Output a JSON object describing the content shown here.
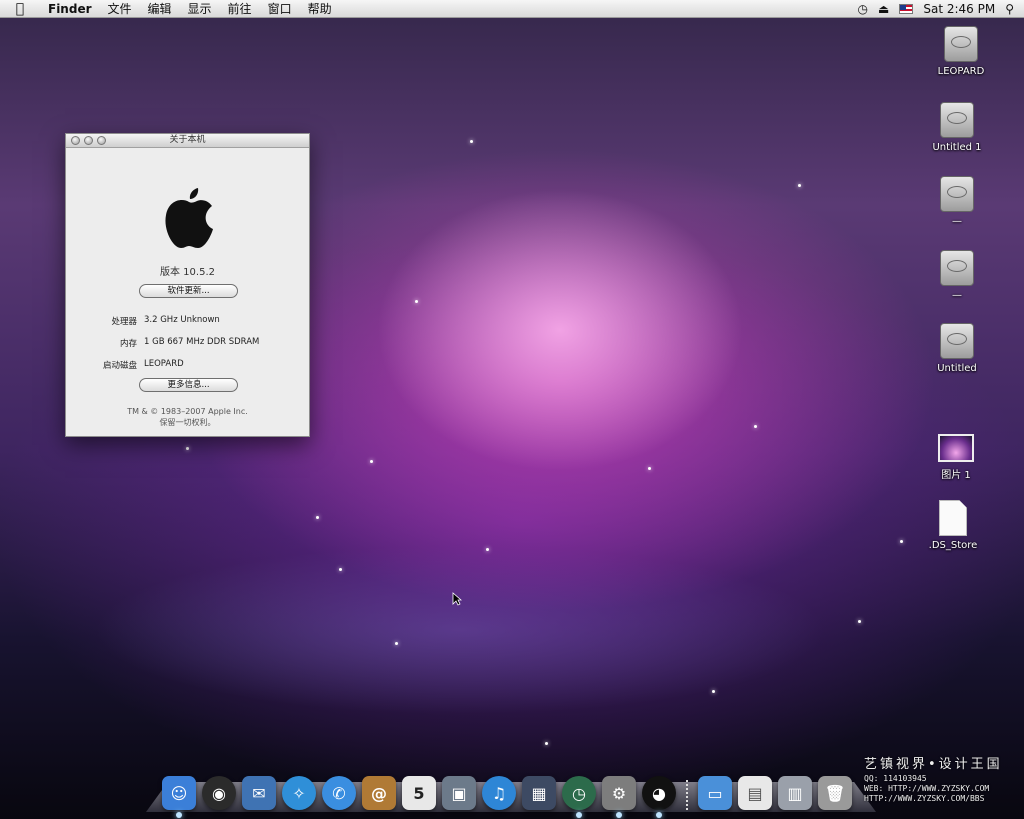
{
  "menubar": {
    "app": "Finder",
    "items": [
      "文件",
      "编辑",
      "显示",
      "前往",
      "窗口",
      "帮助"
    ],
    "clock": "Sat 2:46 PM",
    "status_icons": [
      "time-machine-icon",
      "eject-icon",
      "us-flag-icon",
      "spotlight-icon"
    ]
  },
  "about_window": {
    "title": "关于本机",
    "version": "版本 10.5.2",
    "software_update_button": "软件更新...",
    "rows": [
      {
        "key": "处理器",
        "value": "3.2 GHz Unknown"
      },
      {
        "key": "内存",
        "value": "1 GB 667 MHz DDR SDRAM"
      },
      {
        "key": "启动磁盘",
        "value": "LEOPARD"
      }
    ],
    "more_info_button": "更多信息...",
    "copyright_line1": "TM & © 1983–2007 Apple Inc.",
    "copyright_line2": "保留一切权利。"
  },
  "desktop_icons": [
    {
      "label": "LEOPARD",
      "kind": "drive"
    },
    {
      "label": "Untitled 1",
      "kind": "drive"
    },
    {
      "label": "—",
      "kind": "drive"
    },
    {
      "label": "—",
      "kind": "drive"
    },
    {
      "label": "Untitled",
      "kind": "drive"
    },
    {
      "label": "图片 1",
      "kind": "image"
    },
    {
      "label": ".DS_Store",
      "kind": "document"
    }
  ],
  "dock": {
    "apps": [
      {
        "name": "finder-icon",
        "glyph": "☺",
        "color": "#3b7fd8",
        "running": true
      },
      {
        "name": "dashboard-icon",
        "glyph": "◉",
        "color": "#2b2b2b",
        "running": false
      },
      {
        "name": "mail-icon",
        "glyph": "✉",
        "color": "#3f73b3",
        "running": false
      },
      {
        "name": "safari-icon",
        "glyph": "✧",
        "color": "#2f8fd8",
        "running": false
      },
      {
        "name": "ichat-icon",
        "glyph": "✆",
        "color": "#3a8ee0",
        "running": false
      },
      {
        "name": "address-book-icon",
        "glyph": "@",
        "color": "#b07a35",
        "running": false
      },
      {
        "name": "ical-icon",
        "glyph": "5",
        "color": "#d9d9d9",
        "running": false
      },
      {
        "name": "iphoto-icon",
        "glyph": "▣",
        "color": "#6c7a8a",
        "running": false
      },
      {
        "name": "itunes-icon",
        "glyph": "♫",
        "color": "#2e86d6",
        "running": false
      },
      {
        "name": "spaces-icon",
        "glyph": "▦",
        "color": "#3d4a63",
        "running": false
      },
      {
        "name": "time-machine-icon",
        "glyph": "◷",
        "color": "#2c6b4b",
        "running": true
      },
      {
        "name": "system-preferences-icon",
        "glyph": "⚙",
        "color": "#7d7d7d",
        "running": true
      },
      {
        "name": "qq-icon",
        "glyph": "◕",
        "color": "#111111",
        "running": true
      }
    ],
    "stacks": [
      {
        "name": "folder-icon",
        "glyph": "▭",
        "color": "#4a90d9"
      },
      {
        "name": "document-icon",
        "glyph": "▤",
        "color": "#e8e8e8"
      },
      {
        "name": "stack-icon",
        "glyph": "▥",
        "color": "#9aa0aa"
      },
      {
        "name": "trash-icon",
        "glyph": "🗑",
        "color": "#9a9a9a"
      }
    ]
  },
  "watermark": {
    "title": "艺镇视界•设计王国",
    "line1": "QQ:          114103945",
    "line2": "WEB:  HTTP://WWW.ZYZSKY.COM",
    "line3": "HTTP://WWW.ZYZSKY.COM/BBS"
  }
}
